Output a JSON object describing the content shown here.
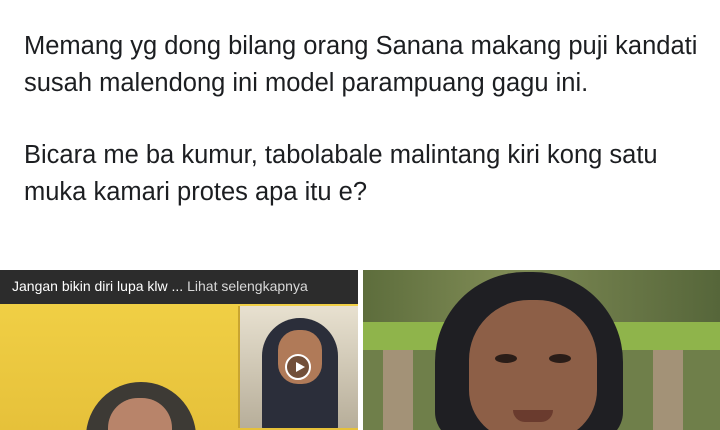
{
  "post": {
    "paragraph_1": "Memang yg dong bilang orang Sanana makang puji kandati susah malendong ini model parampuang gagu ini.",
    "paragraph_2": "Bicara me ba kumur, tabolabale malintang kiri kong satu muka kamari protes apa itu e?"
  },
  "media": {
    "left_tile": {
      "caption": "Jangan bikin diri lupa klw ... ",
      "see_more": "Lihat selengkapnya",
      "play_icon": "play-icon"
    }
  }
}
